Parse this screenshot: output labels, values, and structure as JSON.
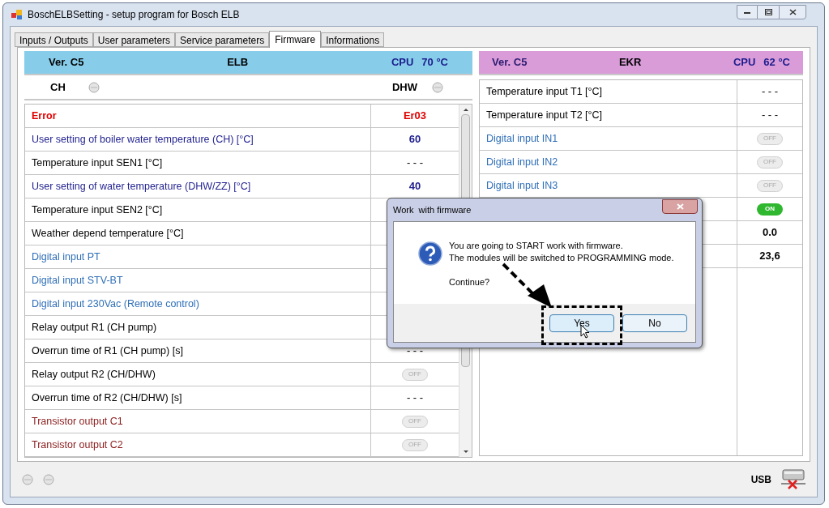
{
  "window": {
    "title": "BoschELBSetting - setup program for Bosch ELB"
  },
  "tabs": [
    {
      "label": "Inputs / Outputs",
      "selected": false
    },
    {
      "label": "User parameters",
      "selected": false
    },
    {
      "label": "Service parameters",
      "selected": false
    },
    {
      "label": "Firmware",
      "selected": true
    },
    {
      "label": "Informations",
      "selected": false
    }
  ],
  "panels": [
    {
      "header": {
        "version": "Ver. C5",
        "module": "ELB",
        "cpu_label": "CPU",
        "cpu_temp": "70 °C"
      },
      "indicators": [
        {
          "label": "CH",
          "on": false
        },
        {
          "label": "DHW",
          "on": false
        }
      ],
      "scrollable": true,
      "rows": [
        {
          "label": "Error",
          "kind": "error",
          "value": "Er03",
          "bold": true
        },
        {
          "label": "User setting of boiler water temperature (CH) [°C]",
          "kind": "setting",
          "value": "60",
          "bold": true
        },
        {
          "label": "Temperature input SEN1 [°C]",
          "kind": "plain",
          "value": "- - -",
          "bold": false
        },
        {
          "label": "User setting of water temperature (DHW/ZZ) [°C]",
          "kind": "setting",
          "value": "40",
          "bold": true
        },
        {
          "label": "Temperature input SEN2 [°C]",
          "kind": "plain"
        },
        {
          "label": "Weather depend temperature [°C]",
          "kind": "plain"
        },
        {
          "label": "Digital input PT",
          "kind": "input"
        },
        {
          "label": "Digital input STV-BT",
          "kind": "input"
        },
        {
          "label": "Digital input 230Vac (Remote control)",
          "kind": "input"
        },
        {
          "label": "Relay output R1 (CH pump)",
          "kind": "plain"
        },
        {
          "label": "Overrun time of R1 (CH pump) [s]",
          "kind": "plain",
          "value": "- - -",
          "bold": false
        },
        {
          "label": "Relay output R2 (CH/DHW)",
          "kind": "plain",
          "switch": "OFF",
          "on": false
        },
        {
          "label": "Overrun time of R2 (CH/DHW) [s]",
          "kind": "plain",
          "value": "- - -",
          "bold": false
        },
        {
          "label": "Transistor output C1",
          "kind": "output",
          "switch": "OFF",
          "on": false
        },
        {
          "label": "Transistor output C2",
          "kind": "output",
          "switch": "OFF",
          "on": false
        }
      ]
    },
    {
      "header": {
        "version": "Ver. C5",
        "module": "EKR",
        "cpu_label": "CPU",
        "cpu_temp": "62 °C"
      },
      "scrollable": false,
      "rows": [
        {
          "label": "Temperature input T1 [°C]",
          "kind": "plain",
          "value": "- - -",
          "bold": false
        },
        {
          "label": "Temperature input T2 [°C]",
          "kind": "plain",
          "value": "- - -",
          "bold": false
        },
        {
          "label": "Digital input IN1",
          "kind": "input",
          "switch": "OFF",
          "on": false
        },
        {
          "label": "Digital input IN2",
          "kind": "input",
          "switch": "OFF",
          "on": false
        },
        {
          "label": "Digital input IN3",
          "kind": "input",
          "switch": "OFF",
          "on": false
        },
        {
          "switch": "ON",
          "on": true
        },
        {
          "value": "0.0",
          "bold": true
        },
        {
          "value": "23,6",
          "bold": true
        }
      ]
    }
  ],
  "dialog": {
    "title": "Work  with firmware",
    "message": "You are going to START work with firmware.\nThe modules will be switched to PROGRAMMING mode.",
    "question": "Continue?",
    "buttons": [
      {
        "label": "Yes",
        "selected": true
      },
      {
        "label": "No",
        "selected": false
      }
    ]
  },
  "status_bar": {
    "leds": [
      {
        "on": false
      },
      {
        "on": false
      }
    ],
    "connection": "USB"
  }
}
